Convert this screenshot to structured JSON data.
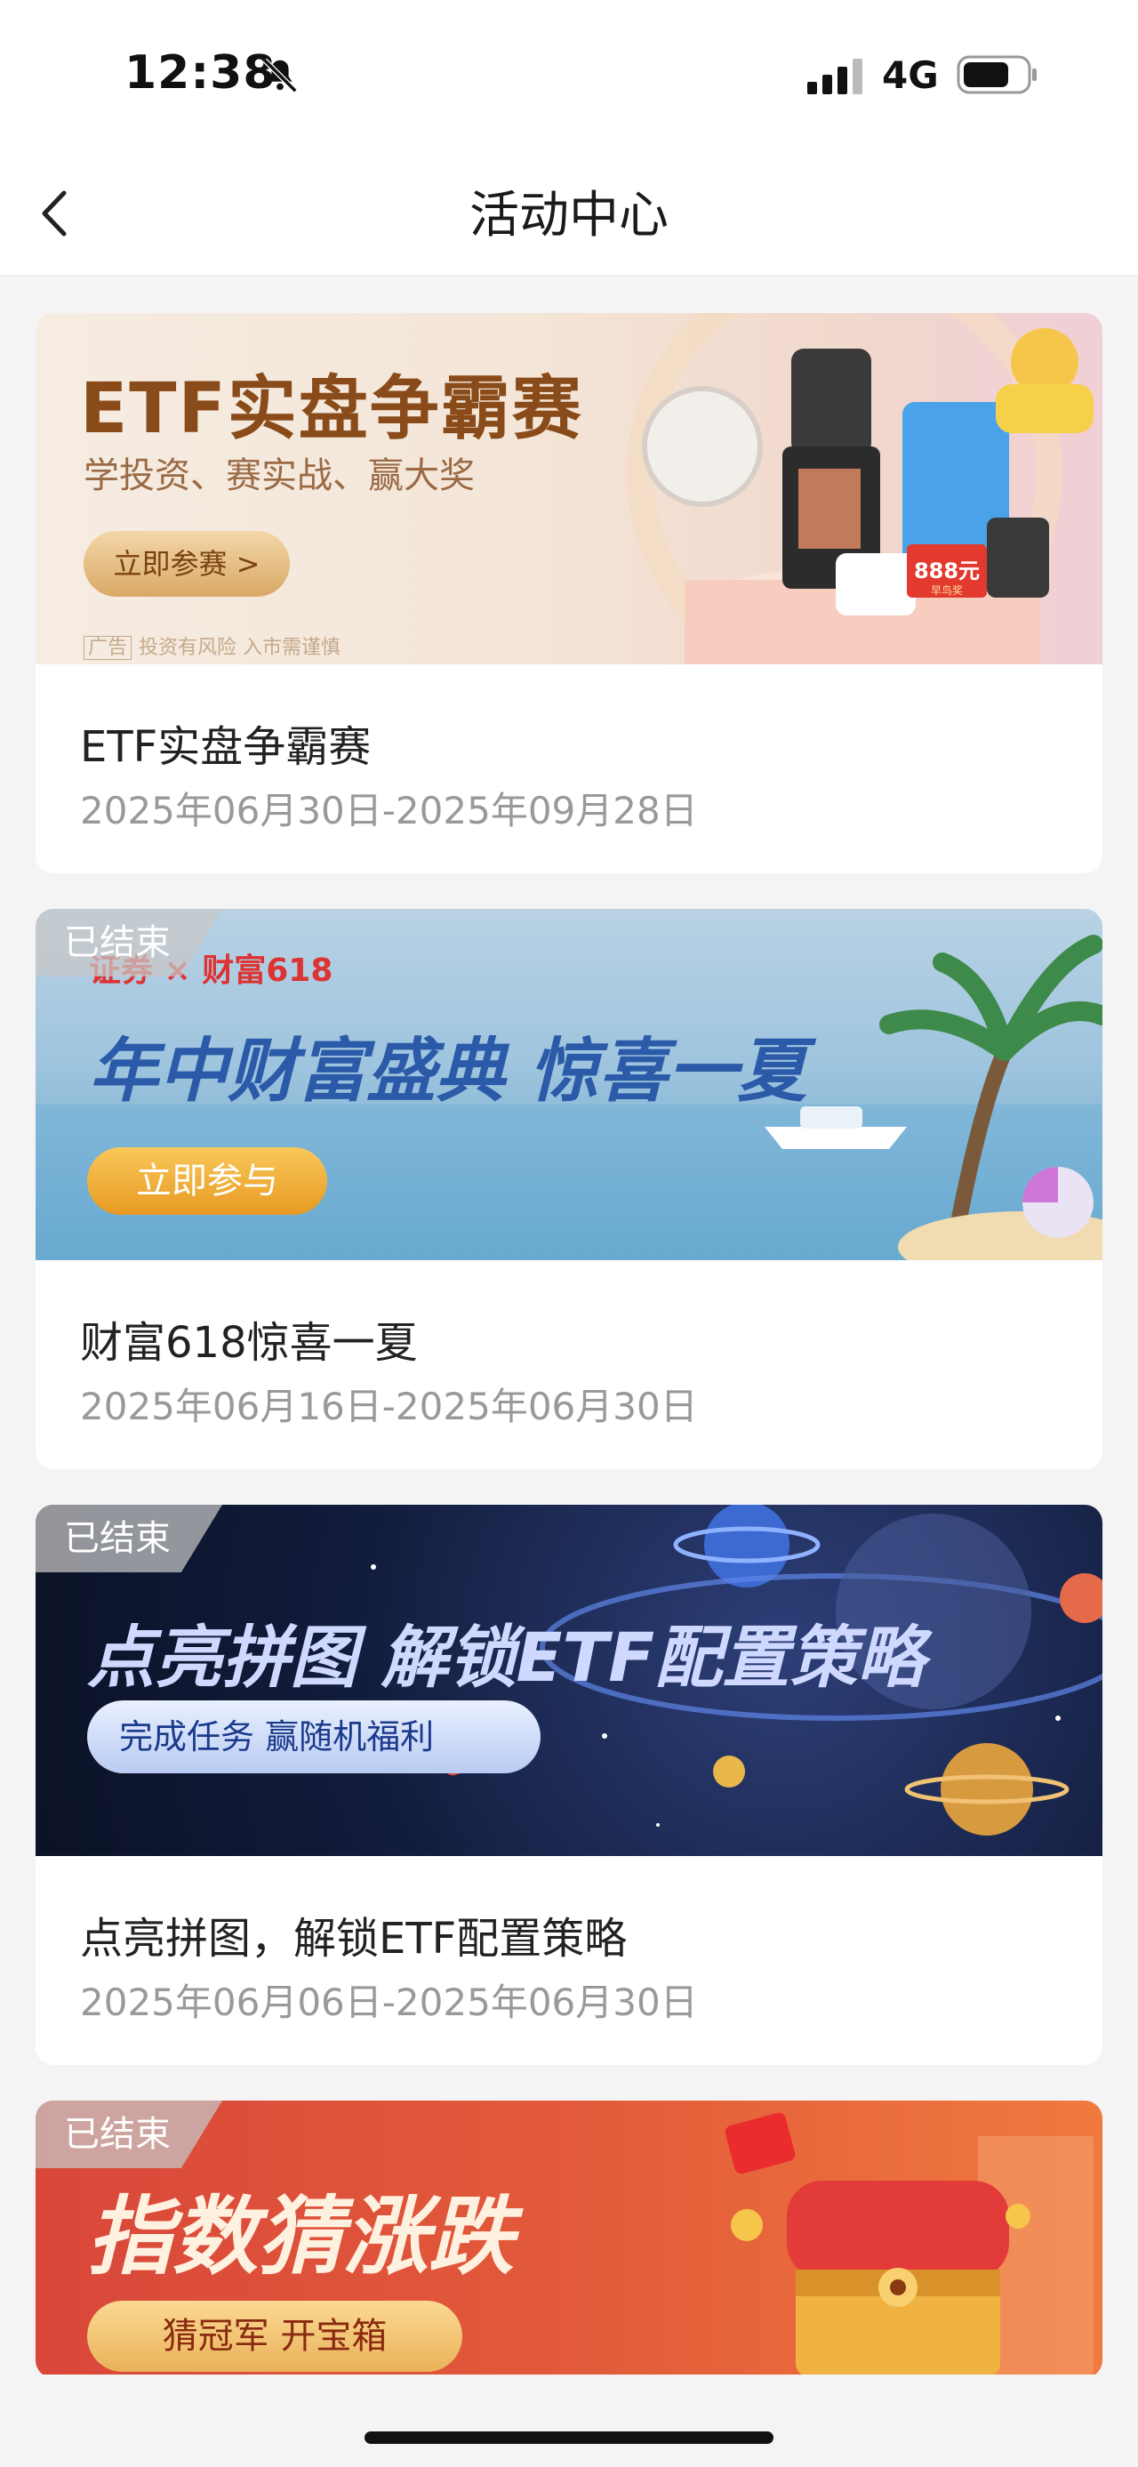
{
  "status_bar": {
    "time": "12:38",
    "network": "4G",
    "icons": [
      "bell-slash-icon",
      "signal-icon",
      "battery-icon"
    ]
  },
  "nav": {
    "title": "活动中心",
    "back_icon": "chevron-left-icon"
  },
  "activities": [
    {
      "title": "ETF实盘争霸赛",
      "date": "2025年06月30日-2025年09月28日",
      "ended": false,
      "banner": {
        "headline": "ETF实盘争霸赛",
        "subline": "学投资、赛实战、赢大奖",
        "button": "立即参赛 >",
        "ad_tag": "广告",
        "disclaimer": "投资有风险 入市需谨慎",
        "price_tag": "888元",
        "price_sub": "早鸟奖"
      }
    },
    {
      "title": "财富618惊喜一夏",
      "date": "2025年06月16日-2025年06月30日",
      "ended": true,
      "ended_label": "已结束",
      "banner": {
        "logo": "证券 × 财富618",
        "headline": "年中财富盛典 惊喜一夏",
        "button": "立即参与"
      }
    },
    {
      "title": "点亮拼图，解锁ETF配置策略",
      "date": "2025年06月06日-2025年06月30日",
      "ended": true,
      "ended_label": "已结束",
      "banner": {
        "headline": "点亮拼图  解锁ETF配置策略",
        "button": "完成任务 赢随机福利"
      }
    },
    {
      "title": "",
      "date": "",
      "ended": true,
      "ended_label": "已结束",
      "banner": {
        "headline": "指数猜涨跌",
        "button": "猜冠军 开宝箱"
      }
    }
  ],
  "colors": {
    "page_bg": "#f4f4f4",
    "card_bg": "#ffffff",
    "date_text": "#999999"
  }
}
